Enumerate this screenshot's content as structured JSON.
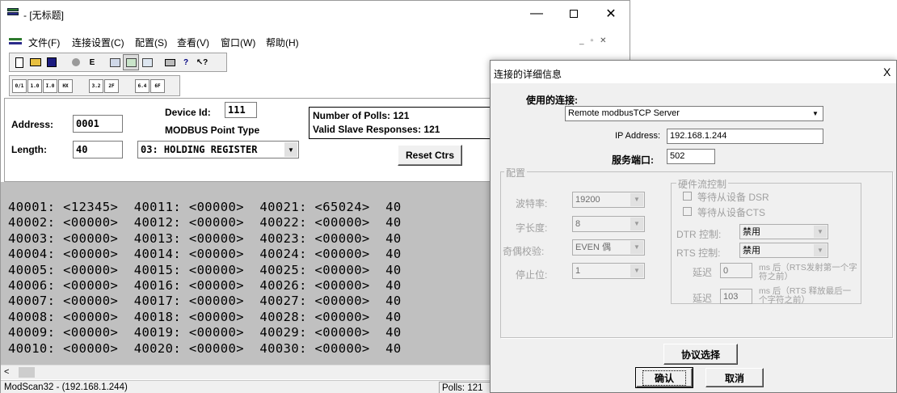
{
  "main": {
    "title": "- [无标题]",
    "menu": [
      "文件(F)",
      "连接设置(C)",
      "配置(S)",
      "查看(V)",
      "窗口(W)",
      "帮助(H)"
    ],
    "toolbar_icons": [
      "new-icon",
      "open-icon",
      "save-icon",
      "disconnect-icon",
      "connect-icon",
      "display-icon",
      "display2-icon",
      "display3-icon",
      "print-icon",
      "help-icon",
      "context-help-icon"
    ],
    "format_buttons": [
      "0/1",
      "1.0",
      "I.0",
      "HX",
      "3.2",
      "2F",
      "6.4",
      "6F"
    ],
    "address_label": "Address:",
    "address_value": "0001",
    "length_label": "Length:",
    "length_value": "40",
    "device_id_label": "Device Id:",
    "device_id_value": "111",
    "point_type_label": "MODBUS Point Type",
    "point_type_value": "03: HOLDING REGISTER",
    "polls_text": "Number of Polls: 121",
    "valid_text": "Valid Slave Responses: 121",
    "reset_label": "Reset Ctrs",
    "rows": [
      "40001: <12345>  40011: <00000>  40021: <65024>  40",
      "40002: <00000>  40012: <00000>  40022: <00000>  40",
      "40003: <00000>  40013: <00000>  40023: <00000>  40",
      "40004: <00000>  40014: <00000>  40024: <00000>  40",
      "40005: <00000>  40015: <00000>  40025: <00000>  40",
      "40006: <00000>  40016: <00000>  40026: <00000>  40",
      "40007: <00000>  40017: <00000>  40027: <00000>  40",
      "40008: <00000>  40018: <00000>  40028: <00000>  40",
      "40009: <00000>  40019: <00000>  40029: <00000>  40",
      "40010: <00000>  40020: <00000>  40030: <00000>  40"
    ],
    "status_left": "ModScan32 - (192.168.1.244)",
    "status_polls": "Polls: 121"
  },
  "dialog": {
    "title": "连接的详细信息",
    "close": "X",
    "use_conn_label": "使用的连接:",
    "use_conn_value": "Remote modbusTCP Server",
    "ip_label": "IP Address:",
    "ip_value": "192.168.1.244",
    "port_label": "服务端口:",
    "port_value": "502",
    "config_group": "配置",
    "baud_label": "波特率:",
    "baud_value": "19200",
    "wordlen_label": "字长度:",
    "wordlen_value": "8",
    "parity_label": "奇偶校验:",
    "parity_value": "EVEN 偶",
    "stop_label": "停止位:",
    "stop_value": "1",
    "hw_group": "硬件流控制",
    "dsr_label": "等待从设备 DSR",
    "cts_label": "等待从设备CTS",
    "dtr_label": "DTR 控制:",
    "dtr_value": "禁用",
    "rts_label": "RTS 控制:",
    "rts_value": "禁用",
    "delay_label": "延迟",
    "delay1_value": "0",
    "delay1_note": "ms 后（RTS发射第一个字符之前）",
    "delay2_value": "103",
    "delay2_note": "ms 后（RTS 释放最后一个字符之前）",
    "protocol_label": "协议选择",
    "ok_label": "确认",
    "cancel_label": "取消"
  }
}
